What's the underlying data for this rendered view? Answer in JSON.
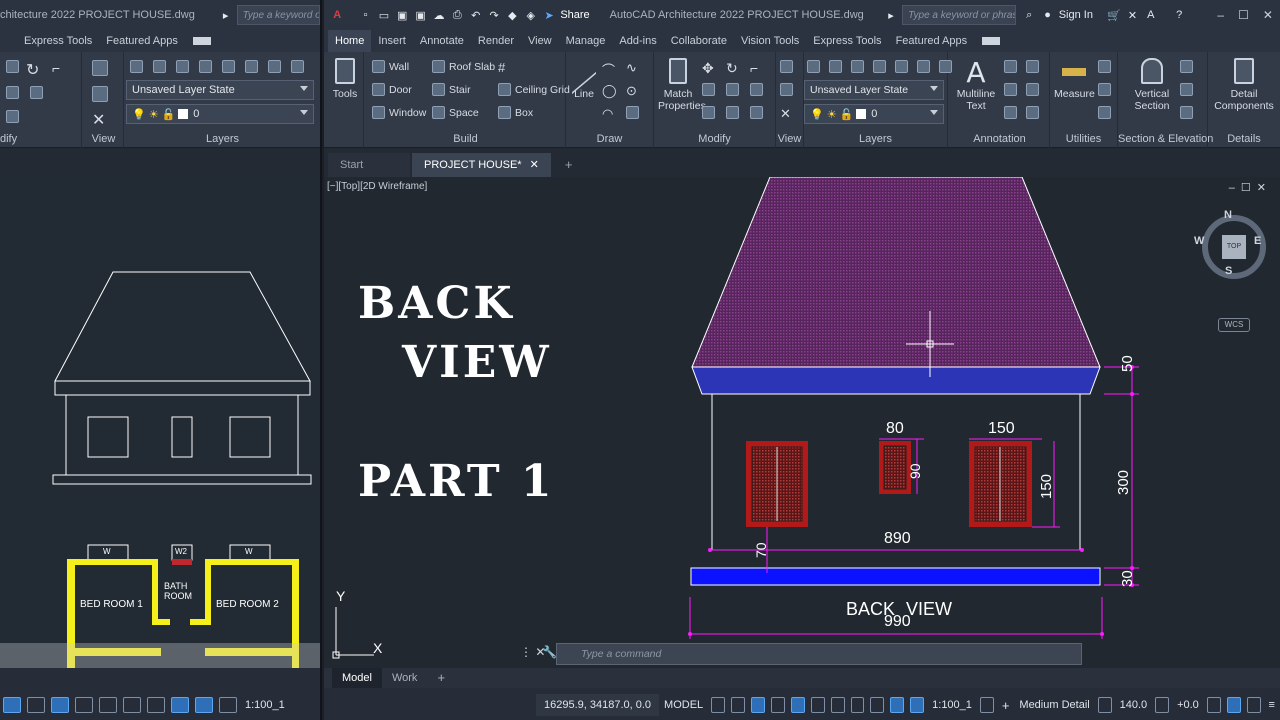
{
  "left_window": {
    "title": "chitecture 2022    PROJECT HOUSE.dwg",
    "search_placeholder": "Type a keyword or p",
    "menu": [
      "Express Tools",
      "Featured Apps"
    ],
    "modify_title": "dify",
    "view_title": "View",
    "layers_title": "Layers",
    "layer_state": "Unsaved Layer State",
    "layer_current": "0",
    "plan": {
      "bed_room_1": "BED ROOM  1",
      "bath_room_line1": "BATH",
      "bath_room_line2": "ROOM",
      "bed_room_2": "BED ROOM  2",
      "w_left": "W",
      "w2": "W2",
      "w_right": "W"
    },
    "scale": "1:100_1"
  },
  "right_window": {
    "title": "AutoCAD Architecture 2022    PROJECT HOUSE.dwg",
    "share_label": "Share",
    "search_placeholder": "Type a keyword or phrase",
    "sign_in": "Sign In",
    "menu_tabs": [
      "Home",
      "Insert",
      "Annotate",
      "Render",
      "View",
      "Manage",
      "Add-ins",
      "Collaborate",
      "Vision Tools",
      "Express Tools",
      "Featured Apps"
    ],
    "ribbon": {
      "tools": "Tools",
      "wall": "Wall",
      "door": "Door",
      "window": "Window",
      "roof_slab": "Roof Slab",
      "stair": "Stair",
      "space": "Space",
      "ceiling_grid": "Ceiling Grid",
      "box": "Box",
      "build_title": "Build",
      "line": "Line",
      "draw_title": "Draw",
      "match_properties_1": "Match",
      "match_properties_2": "Properties",
      "modify_title": "Modify",
      "view_title": "View",
      "layer_state": "Unsaved Layer State",
      "layer_current": "0",
      "layers_title": "Layers",
      "multiline_text_1": "Multiline",
      "multiline_text_2": "Text",
      "annotation_title": "Annotation",
      "measure": "Measure",
      "utilities_title": "Utilities",
      "vertical_section_1": "Vertical",
      "vertical_section_2": "Section",
      "section_title": "Section & Elevation",
      "detail_components_1": "Detail",
      "detail_components_2": "Components",
      "details_title": "Details"
    },
    "doc_tabs": [
      "Start",
      "PROJECT HOUSE*"
    ],
    "viewport_label": "[−][Top][2D Wireframe]",
    "promo": {
      "line1": "BACK",
      "line2": "VIEW",
      "line3": "PART 1"
    },
    "drawing": {
      "dim_roof": "50",
      "dim_wall": "300",
      "dim_base": "30",
      "dim_small_w": "80",
      "dim_small_h": "90",
      "dim_large_w": "150",
      "dim_large_h": "150",
      "dim_sill": "70",
      "dim_wall_width": "890",
      "dim_base_width": "990",
      "caption_back": "BACK",
      "caption_view": "VIEW"
    },
    "compass": {
      "n": "N",
      "s": "S",
      "e": "E",
      "w": "W",
      "top": "TOP",
      "wcs": "WCS"
    },
    "ucs": {
      "x": "X",
      "y": "Y"
    },
    "command_placeholder": "Type a command",
    "layout_tabs": [
      "Model",
      "Work"
    ],
    "status": {
      "coords": "16295.9, 34187.0, 0.0",
      "model": "MODEL",
      "scale": "1:100_1",
      "detail": "Medium Detail",
      "elevation": "140.0",
      "offset": "+0.0"
    }
  },
  "colors": {
    "roof_fill": "#6a2d6e",
    "fascia": "#2b35b5",
    "base_slab": "#0a12ff",
    "window_frame": "#b21a1a",
    "dimension": "#ff1aff",
    "plan_walls": "#f6f01a"
  }
}
